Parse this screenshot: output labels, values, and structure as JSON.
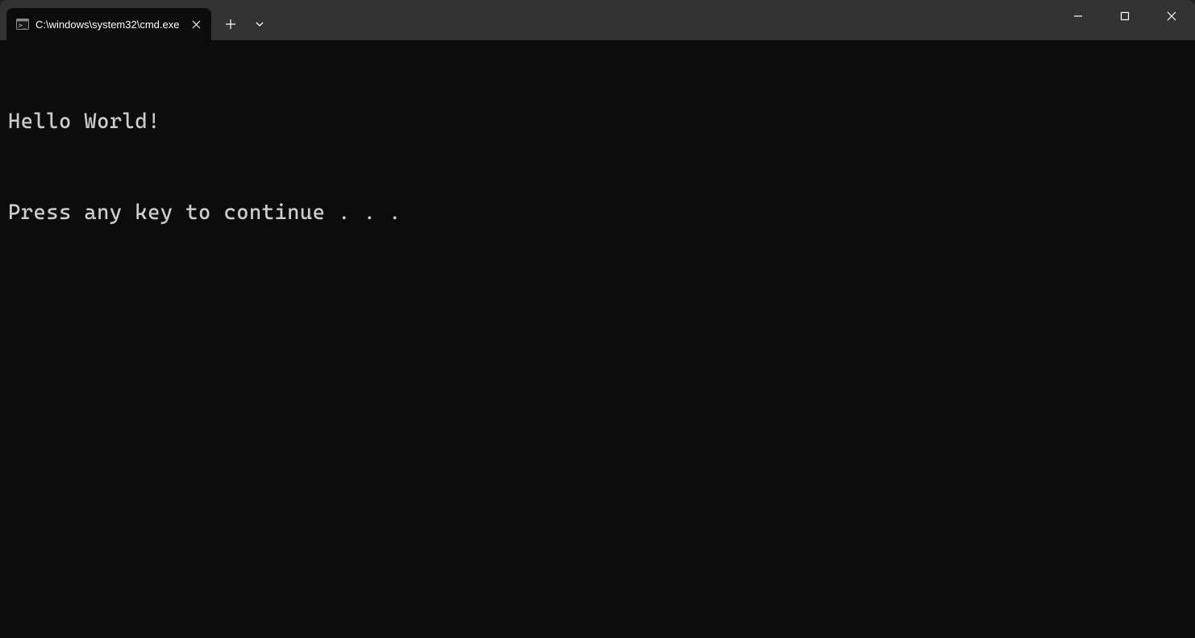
{
  "tab": {
    "title": "C:\\windows\\system32\\cmd.exe",
    "icon": "terminal-icon"
  },
  "terminal": {
    "lines": [
      "Hello World!",
      "Press any key to continue . . ."
    ]
  }
}
